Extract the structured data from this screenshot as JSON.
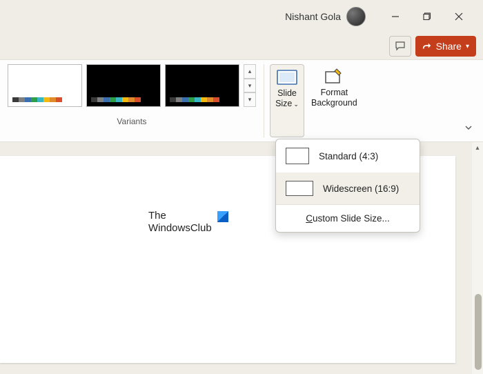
{
  "titlebar": {
    "user_name": "Nishant Gola"
  },
  "sharerow": {
    "share_label": "Share"
  },
  "ribbon": {
    "variants_label": "Variants",
    "swatch_colors": [
      "#3a3a3a",
      "#7f7f7f",
      "#3a6fb0",
      "#2e9e47",
      "#37b6c4",
      "#f2b90f",
      "#e08a2c",
      "#d94f2c"
    ],
    "slide_size": {
      "line1": "Slide",
      "line2": "Size"
    },
    "format_bg": {
      "line1": "Format",
      "line2": "Background"
    }
  },
  "menu": {
    "standard": "Standard (4:3)",
    "widescreen": "Widescreen (16:9)",
    "custom": "Custom Slide Size..."
  },
  "slide": {
    "logo_line1": "The",
    "logo_line2": "WindowsClub"
  }
}
